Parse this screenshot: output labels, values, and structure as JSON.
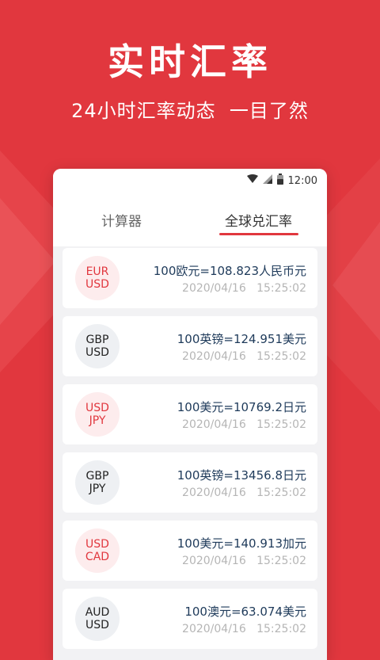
{
  "hero": {
    "title": "实时汇率",
    "subtitle": "24小时汇率动态  一目了然"
  },
  "statusbar": {
    "time": "12:00",
    "icons": [
      "wifi-icon",
      "signal-icon",
      "battery-icon"
    ]
  },
  "tabs": [
    {
      "label": "计算器",
      "active": false
    },
    {
      "label": "全球兑汇率",
      "active": true
    }
  ],
  "colors": {
    "accent": "#e1373e",
    "rate_text": "#1e3a5a",
    "time_text": "#b5b5b5"
  },
  "rates": [
    {
      "top": "EUR",
      "bottom": "USD",
      "style": "red",
      "rate": "100欧元=108.823人民币元",
      "date": "2020/04/16",
      "time": "15:25:02"
    },
    {
      "top": "GBP",
      "bottom": "USD",
      "style": "dark",
      "rate": "100英镑=124.951美元",
      "date": "2020/04/16",
      "time": "15:25:02"
    },
    {
      "top": "USD",
      "bottom": "JPY",
      "style": "red",
      "rate": "100美元=10769.2日元",
      "date": "2020/04/16",
      "time": "15:25:02"
    },
    {
      "top": "GBP",
      "bottom": "JPY",
      "style": "dark",
      "rate": "100英镑=13456.8日元",
      "date": "2020/04/16",
      "time": "15:25:02"
    },
    {
      "top": "USD",
      "bottom": "CAD",
      "style": "red",
      "rate": "100美元=140.913加元",
      "date": "2020/04/16",
      "time": "15:25:02"
    },
    {
      "top": "AUD",
      "bottom": "USD",
      "style": "dark",
      "rate": "100澳元=63.074美元",
      "date": "2020/04/16",
      "time": "15:25:02"
    }
  ]
}
